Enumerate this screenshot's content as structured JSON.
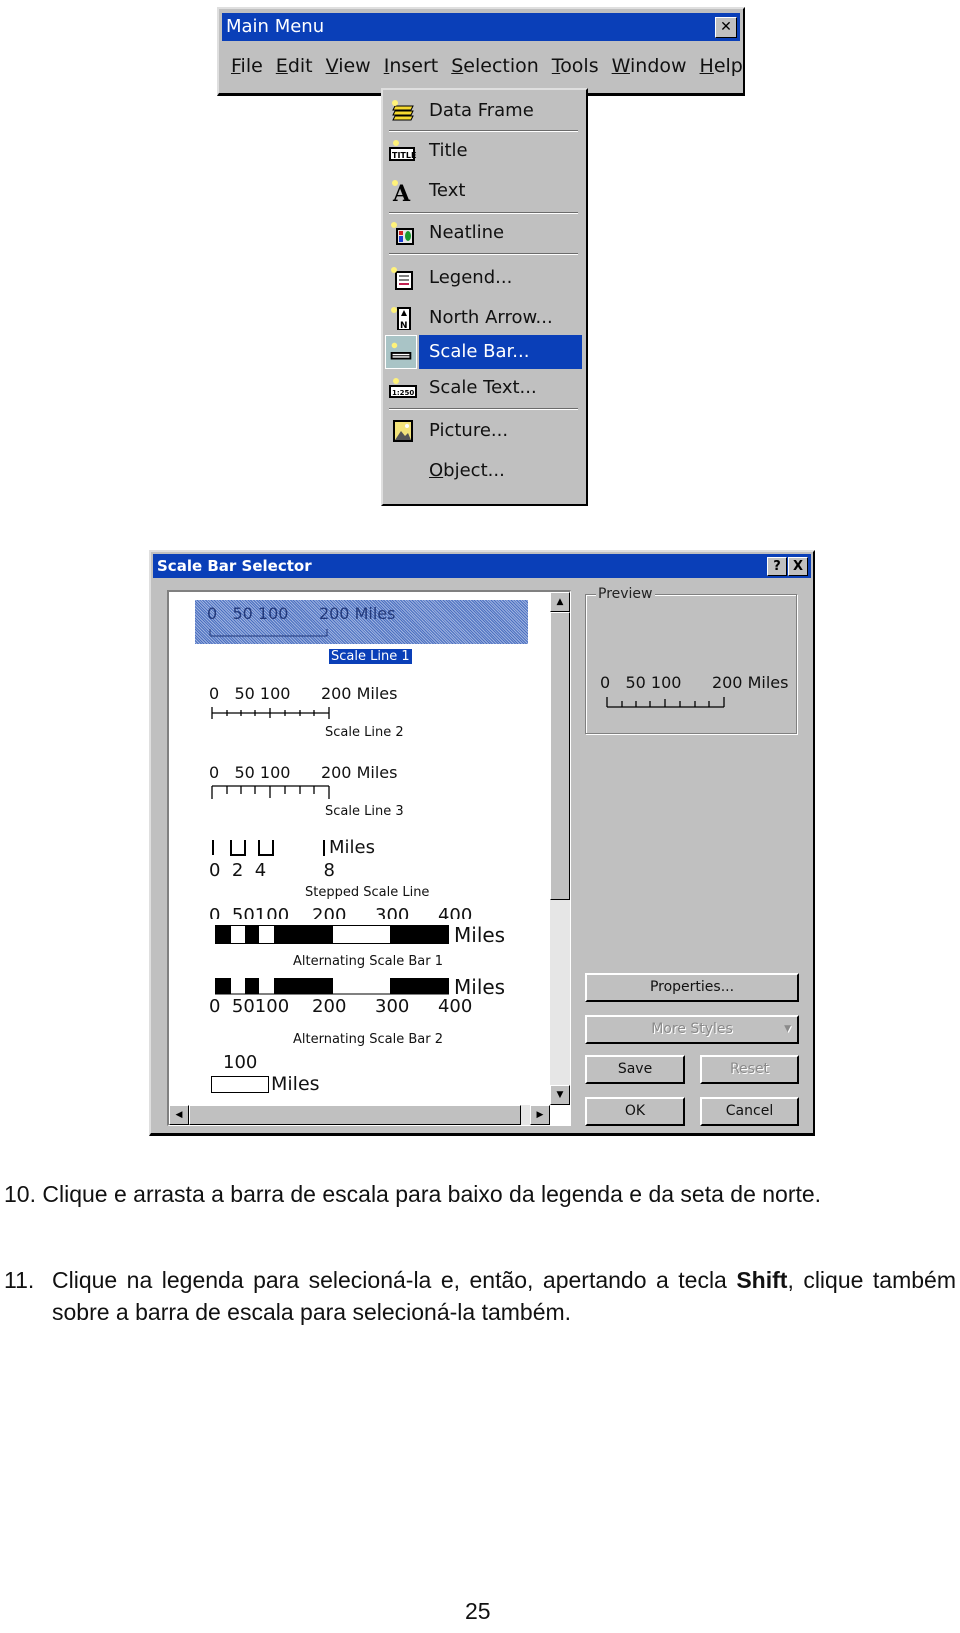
{
  "main_menu": {
    "title": "Main Menu",
    "close_glyph": "✕",
    "menus": [
      {
        "label": "File",
        "mnemonic": "F"
      },
      {
        "label": "Edit",
        "mnemonic": "E"
      },
      {
        "label": "View",
        "mnemonic": "V"
      },
      {
        "label": "Insert",
        "mnemonic": "I"
      },
      {
        "label": "Selection",
        "mnemonic": "S"
      },
      {
        "label": "Tools",
        "mnemonic": "T"
      },
      {
        "label": "Window",
        "mnemonic": "W"
      },
      {
        "label": "Help",
        "mnemonic": "H"
      }
    ],
    "insert_dropdown": {
      "items": [
        {
          "label": "Data Frame",
          "icon": "data-frame-icon"
        },
        {
          "label": "Title",
          "icon": "title-icon"
        },
        {
          "label": "Text",
          "icon": "text-icon"
        },
        {
          "label": "Neatline",
          "icon": "neatline-icon"
        },
        {
          "label": "Legend...",
          "icon": "legend-icon"
        },
        {
          "label": "North Arrow...",
          "icon": "north-arrow-icon"
        },
        {
          "label": "Scale Bar...",
          "icon": "scale-bar-icon",
          "selected": true
        },
        {
          "label": "Scale Text...",
          "icon": "scale-text-icon"
        },
        {
          "label": "Picture...",
          "icon": "picture-icon"
        },
        {
          "label": "Object...",
          "icon": "object-icon"
        }
      ]
    }
  },
  "dialog": {
    "title": "Scale Bar Selector",
    "help_glyph": "?",
    "close_glyph": "X",
    "styles": [
      {
        "name": "Scale Line 1",
        "numbers": "0   50 100      200 Miles",
        "selected": true
      },
      {
        "name": "Scale Line 2",
        "numbers": "0   50 100      200 Miles"
      },
      {
        "name": "Scale Line 3",
        "numbers": "0   50 100      200 Miles"
      },
      {
        "name": "Stepped Scale Line",
        "numbers": "0  2  4          8",
        "unit": "Miles"
      },
      {
        "name": "Alternating Scale Bar 1",
        "numbers": "0  50100    200     300     400",
        "unit": "Miles"
      },
      {
        "name": "Alternating Scale Bar 2",
        "numbers": "0  50100    200     300     400",
        "unit": "Miles"
      },
      {
        "name": "",
        "numbers": "100",
        "unit": "Miles"
      }
    ],
    "preview": {
      "label": "Preview",
      "numbers": "0   50 100      200 Miles"
    },
    "buttons": {
      "properties": "Properties...",
      "more_styles": "More Styles",
      "save": "Save",
      "reset": "Reset",
      "ok": "OK",
      "cancel": "Cancel"
    }
  },
  "document": {
    "step10_number": "10.",
    "step10_text": "Clique e arrasta a barra de escala para baixo da legenda e da seta de norte.",
    "step11_number": "11.",
    "step11_text_a": "Clique na legenda para selecioná-la e, então, apertando a tecla ",
    "step11_bold": "Shift",
    "step11_text_b": ", clique também sobre a barra de escala para selecioná-la também.",
    "page_number": "25"
  }
}
